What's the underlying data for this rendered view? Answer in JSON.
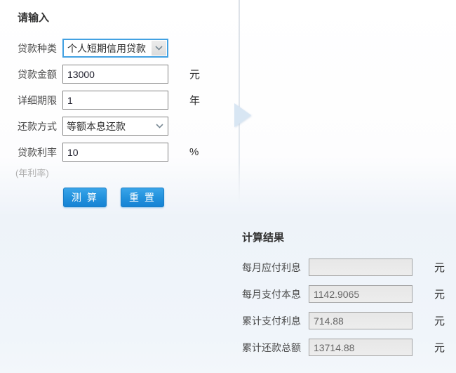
{
  "colors": {
    "button_blue": "#2392dd",
    "select_focus_border": "#42a1e2",
    "arrow_fill": "#d8e6f3",
    "result_field_bg": "#ebebeb"
  },
  "input_panel": {
    "title": "请输入",
    "loan_type": {
      "label": "贷款种类",
      "value": "个人短期信用贷款"
    },
    "loan_amount": {
      "label": "贷款金额",
      "value": "13000",
      "unit": "元"
    },
    "loan_term": {
      "label": "详细期限",
      "value": "1",
      "unit": "年"
    },
    "repayment_method": {
      "label": "还款方式",
      "value": "等额本息还款"
    },
    "interest_rate": {
      "label": "贷款利率",
      "value": "10",
      "unit": "%",
      "note": "(年利率)"
    },
    "calculate_button": "测 算",
    "reset_button": "重 置"
  },
  "result_panel": {
    "title": "计算结果",
    "monthly_interest": {
      "label": "每月应付利息",
      "value": "",
      "unit": "元"
    },
    "monthly_principal_interest": {
      "label": "每月支付本息",
      "value": "1142.9065",
      "unit": "元"
    },
    "total_interest": {
      "label": "累计支付利息",
      "value": "714.88",
      "unit": "元"
    },
    "total_repayment": {
      "label": "累计还款总额",
      "value": "13714.88",
      "unit": "元"
    }
  }
}
